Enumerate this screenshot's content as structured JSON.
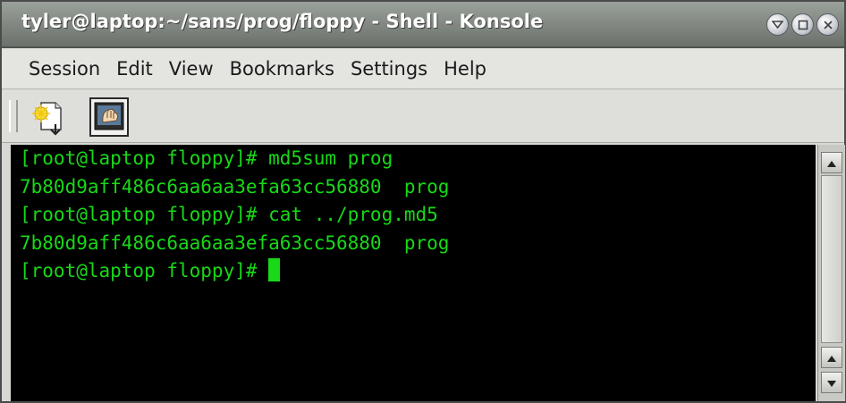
{
  "window": {
    "title": "tyler@laptop:~/sans/prog/floppy - Shell - Konsole"
  },
  "title_buttons": {
    "icons": [
      "menu-icon",
      "maximize-icon",
      "close-icon"
    ]
  },
  "menu": {
    "items": [
      {
        "label": "Session"
      },
      {
        "label": "Edit"
      },
      {
        "label": "View"
      },
      {
        "label": "Bookmarks"
      },
      {
        "label": "Settings"
      },
      {
        "label": "Help"
      }
    ]
  },
  "toolbar": {
    "icons": [
      "new-session-icon",
      "konsole-session-icon"
    ]
  },
  "terminal": {
    "lines": [
      "[root@laptop floppy]# md5sum prog",
      "7b80d9aff486c6aa6aa3efa63cc56880  prog",
      "[root@laptop floppy]# cat ../prog.md5",
      "7b80d9aff486c6aa6aa3efa63cc56880  prog",
      "[root@laptop floppy]# "
    ],
    "text_color": "#18d818",
    "background": "#000000"
  }
}
